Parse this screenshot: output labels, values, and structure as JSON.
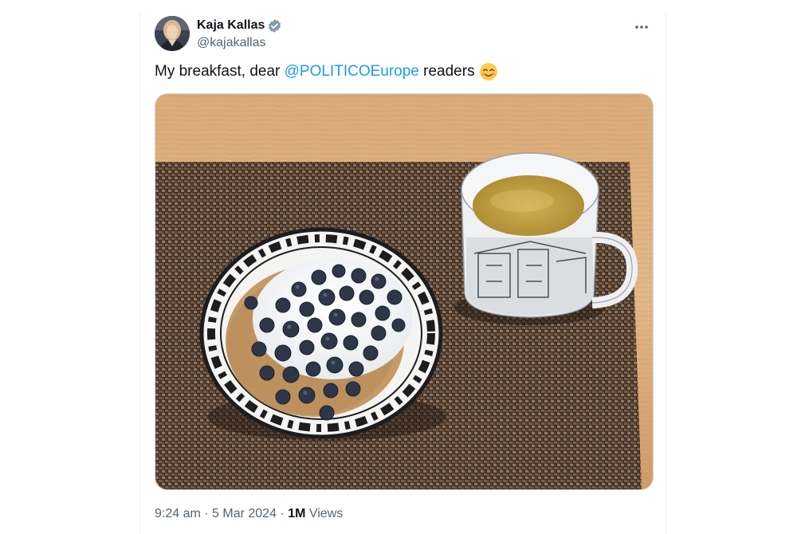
{
  "author": {
    "display_name": "Kaja Kallas",
    "handle": "@kajakallas",
    "verified_icon": "verified-badge-icon",
    "avatar": "avatar"
  },
  "tweet": {
    "text_prefix": "My breakfast, dear ",
    "mention": "@POLITICOEurope",
    "text_suffix": " readers",
    "emoji": "smiling-face-with-smiling-eyes-emoji",
    "image": "breakfast-photo"
  },
  "meta": {
    "time": "9:24 am",
    "separator": " · ",
    "date": "5 Mar 2024",
    "separator2": " · ",
    "views_count": "1M",
    "views_label": " Views"
  },
  "colors": {
    "link": "#1d9bf0",
    "text": "#0f1419",
    "secondary": "#536471",
    "verified": "#829aab"
  }
}
